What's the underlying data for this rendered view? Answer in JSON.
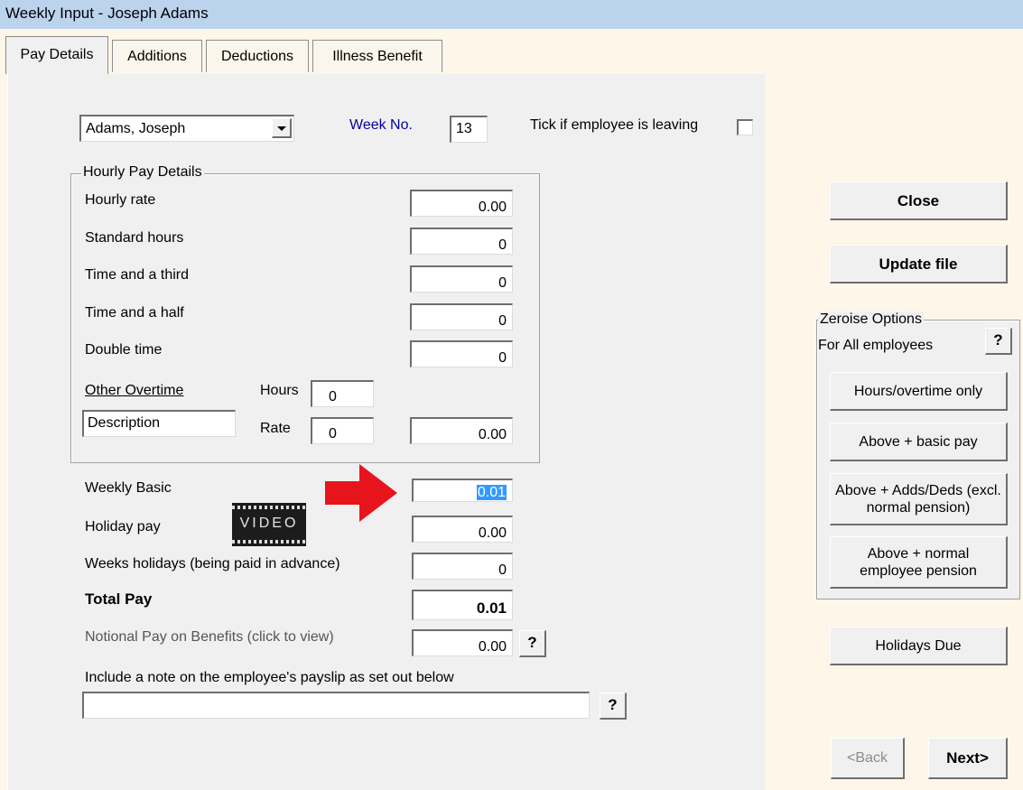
{
  "window": {
    "title": "Weekly Input - Joseph Adams"
  },
  "tabs": [
    {
      "label": "Pay Details",
      "active": true
    },
    {
      "label": "Additions",
      "active": false
    },
    {
      "label": "Deductions",
      "active": false
    },
    {
      "label": "Illness Benefit",
      "active": false
    }
  ],
  "header": {
    "employee_selected": "Adams, Joseph",
    "week_label": "Week No.",
    "week_value": "13",
    "leaving_label": "Tick if employee is leaving",
    "leaving_checked": false
  },
  "hourly": {
    "legend": "Hourly Pay Details",
    "rows": [
      {
        "label": "Hourly rate",
        "value": "0.00"
      },
      {
        "label": "Standard hours",
        "value": "0"
      },
      {
        "label": "Time and a third",
        "value": "0"
      },
      {
        "label": "Time and a half",
        "value": "0"
      },
      {
        "label": "Double time",
        "value": "0"
      }
    ],
    "other_overtime_label": "Other Overtime",
    "hours_label": "Hours",
    "hours_value": "0",
    "description_value": "Description",
    "rate_label": "Rate",
    "rate_value": "0",
    "overtime_total": "0.00"
  },
  "pay": {
    "weekly_basic_label": "Weekly Basic",
    "weekly_basic_value": "0.01",
    "holiday_pay_label": "Holiday pay",
    "holiday_pay_value": "0.00",
    "video_label": "VIDEO",
    "weeks_holidays_label": "Weeks holidays (being paid in advance)",
    "weeks_holidays_value": "0",
    "total_pay_label": "Total Pay",
    "total_pay_value": "0.01",
    "notional_label": "Notional Pay on Benefits (click to view)",
    "notional_value": "0.00",
    "note_label": "Include a note on the employee's payslip as set out below",
    "note_value": "",
    "help_glyph": "?"
  },
  "side": {
    "close_label": "Close",
    "update_label": "Update file",
    "zeroise_legend": "Zeroise Options",
    "zeroise_subtitle": "For All employees",
    "zeroise_buttons": [
      "Hours/overtime only",
      "Above + basic pay",
      "Above + Adds/Deds (excl. normal pension)",
      "Above + normal employee pension"
    ],
    "holidays_due_label": "Holidays Due",
    "back_label": "<Back",
    "next_label": "Next>"
  },
  "colors": {
    "accent": "#0000a0",
    "arrow": "#e8141c",
    "selection": "#3399ff",
    "titlebar": "#bcd3ee"
  },
  "icons": {
    "dropdown": "chevron-down-icon",
    "arrow": "red-arrow-icon",
    "video": "video-icon"
  }
}
